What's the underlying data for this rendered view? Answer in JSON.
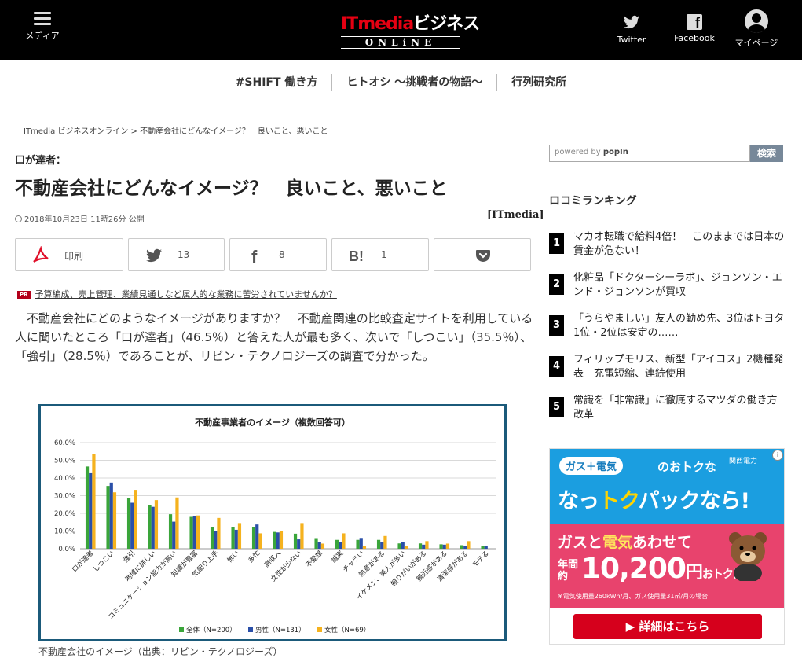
{
  "header": {
    "menu_label": "メディア",
    "logo_primary": "ITmedia",
    "logo_secondary": "ビジネス",
    "logo_sub": "ONLiNE",
    "twitter_label": "Twitter",
    "facebook_label": "Facebook",
    "mypage_label": "マイページ"
  },
  "nav": {
    "items": [
      "#SHIFT 働き方",
      "ヒトオシ 〜挑戦者の物語〜",
      "行列研究所"
    ]
  },
  "breadcrumb": "ITmedia ビジネスオンライン > 不動産会社にどんなイメージ？　良いこと、悪いこと",
  "article": {
    "kicker": "口が達者：",
    "title": "不動産会社にどんなイメージ？　良いこと、悪いこと",
    "dateline": "2018年10月23日 11時26分 公開",
    "source": "[ITmedia]",
    "share": {
      "print_label": "印刷",
      "twitter_count": "13",
      "facebook_count": "8",
      "hatena_count": "1"
    },
    "pr_badge": "PR",
    "pr_link": "予算編成、売上管理、業績見通しなど属人的な業務に苦労されていませんか？",
    "body": "　不動産会社にどのようなイメージがありますか？　不動産関連の比較査定サイトを利用している人に聞いたところ「口が達者」（46.5％）と答えた人が最も多く、次いで「しつこい」（35.5％）、「強引」（28.5％）であることが、リビン・テクノロジーズの調査で分かった。",
    "figure_caption": "不動産会社のイメージ（出典：リビン・テクノロジーズ）"
  },
  "chart_data": {
    "type": "bar",
    "title": "不動産事業者のイメージ（複数回答可）",
    "categories": [
      "口が達者",
      "しつこい",
      "強引",
      "地域に詳しい",
      "コミュニケーション能力が高い",
      "知識が豊富",
      "気配り上手",
      "怖い",
      "多忙",
      "高収入",
      "女性が少ない",
      "不愛想",
      "誠実",
      "チャラい",
      "熱意がある",
      "イケメン、美人が多い",
      "頼りがいがある",
      "親近感がある",
      "清潔感がある",
      "モテる"
    ],
    "ylim": [
      0,
      60
    ],
    "yticks": [
      "0.0%",
      "10.0%",
      "20.0%",
      "30.0%",
      "40.0%",
      "50.0%",
      "60.0%"
    ],
    "series": [
      {
        "name": "全体（N=200）",
        "color": "#3aa53a",
        "values": [
          46.5,
          35.5,
          28.5,
          24.5,
          19.5,
          18,
          12,
          12,
          12,
          9.5,
          8.5,
          6,
          5,
          5,
          5,
          3,
          3,
          2.5,
          2,
          1.5
        ]
      },
      {
        "name": "男性（N=131）",
        "color": "#2a4fa8",
        "values": [
          42.7,
          37.4,
          26,
          23.7,
          15.3,
          18.3,
          9.9,
          10.7,
          13.7,
          9.2,
          5.3,
          3.8,
          3.8,
          6.1,
          3.8,
          3.8,
          2.3,
          2.3,
          1.5,
          1.5
        ]
      },
      {
        "name": "女性（N=69）",
        "color": "#f5b21e",
        "values": [
          53.6,
          31.9,
          33.3,
          27.5,
          29,
          18.8,
          17.4,
          14.5,
          8.7,
          10.1,
          14.5,
          2.9,
          8.7,
          1.4,
          7.2,
          1.4,
          4.3,
          2.9,
          4.3,
          0
        ]
      }
    ],
    "grid": true,
    "legend": "bottom"
  },
  "sidebar": {
    "search_placeholder": "powered by",
    "search_brand": "popIn",
    "search_button": "検索",
    "ranking_title": "ロコミランキング",
    "ranking": [
      {
        "num": "1",
        "text": "マカオ転職で給料4倍！　このままでは日本の賃金が危ない！"
      },
      {
        "num": "2",
        "text": "化粧品「ドクターシーラボ」、ジョンソン・エンド・ジョンソンが買収"
      },
      {
        "num": "3",
        "text": "「うらやましい」友人の勤め先、3位はトヨタ　1位・2位は安定の……"
      },
      {
        "num": "4",
        "text": "フィリップモリス、新型「アイコス」2機種発表　充電短縮、連続使用"
      },
      {
        "num": "5",
        "text": "常識を「非常識」に徹底するマツダの働き方改革"
      }
    ]
  },
  "ad": {
    "gas_label": "ガス＋電気",
    "otoku": "のおトクな",
    "brand": "関西電力",
    "pack_pre": "なっ",
    "pack_tk": "トク",
    "pack_post": "パックなら!",
    "gas_pre": "ガスと",
    "gas_y": "電気",
    "gas_post": "あわせて",
    "nen": "年間約",
    "price": "10,200",
    "price_en": "円",
    "price_ot": "おトクに!",
    "note": "※電気使用量260kWh/月、ガス使用量31㎥/月の場合",
    "cta": "詳細はこちら"
  }
}
